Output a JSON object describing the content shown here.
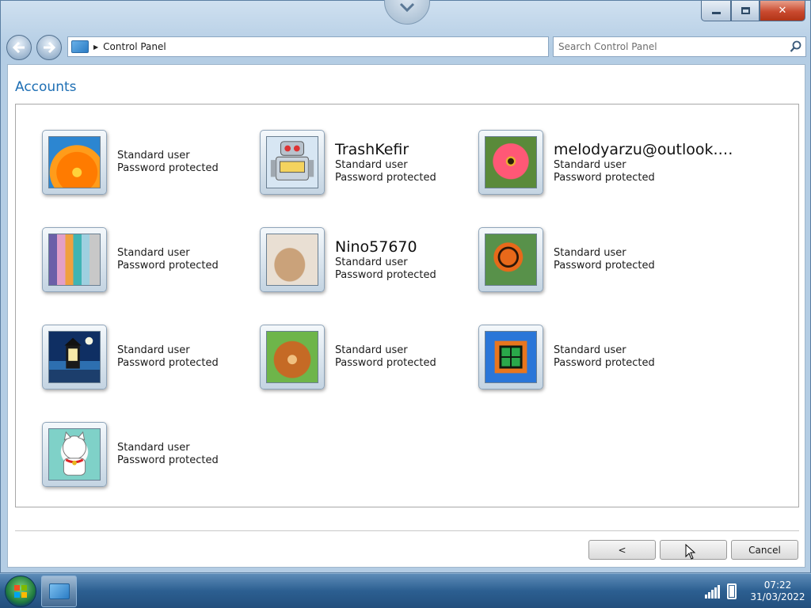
{
  "window": {
    "controls": {
      "minimize_icon": "minimize-icon",
      "maximize_icon": "maximize-icon",
      "close_label": "✕"
    }
  },
  "address_bar": {
    "breadcrumb": "Control Panel"
  },
  "search": {
    "placeholder": "Search Control Panel",
    "icon": "search-icon"
  },
  "page": {
    "title": "Accounts"
  },
  "accounts": [
    {
      "name": "",
      "type": "Standard user",
      "status": "Password protected",
      "picture": "orange-flower"
    },
    {
      "name": "TrashKefir",
      "type": "Standard user",
      "status": "Password protected",
      "picture": "robot"
    },
    {
      "name": "melodyarzu@outlook.…",
      "type": "Standard user",
      "status": "Password protected",
      "picture": "pink-flower"
    },
    {
      "name": "",
      "type": "Standard user",
      "status": "Password protected",
      "picture": "crayons"
    },
    {
      "name": "Nino57670",
      "type": "Standard user",
      "status": "Password protected",
      "picture": "kitten"
    },
    {
      "name": "",
      "type": "Standard user",
      "status": "Password protected",
      "picture": "butterfly"
    },
    {
      "name": "",
      "type": "Standard user",
      "status": "Password protected",
      "picture": "lighthouse"
    },
    {
      "name": "",
      "type": "Standard user",
      "status": "Password protected",
      "picture": "dog"
    },
    {
      "name": "",
      "type": "Standard user",
      "status": "Password protected",
      "picture": "window"
    },
    {
      "name": "",
      "type": "Standard user",
      "status": "Password protected",
      "picture": "lucky-cat"
    }
  ],
  "buttons": {
    "back": "<",
    "next": "",
    "cancel": "Cancel"
  },
  "taskbar": {
    "time": "07:22",
    "date": "31/03/2022"
  },
  "colors": {
    "title_blue": "#1e6fb4",
    "close_red": "#c94a2f"
  }
}
